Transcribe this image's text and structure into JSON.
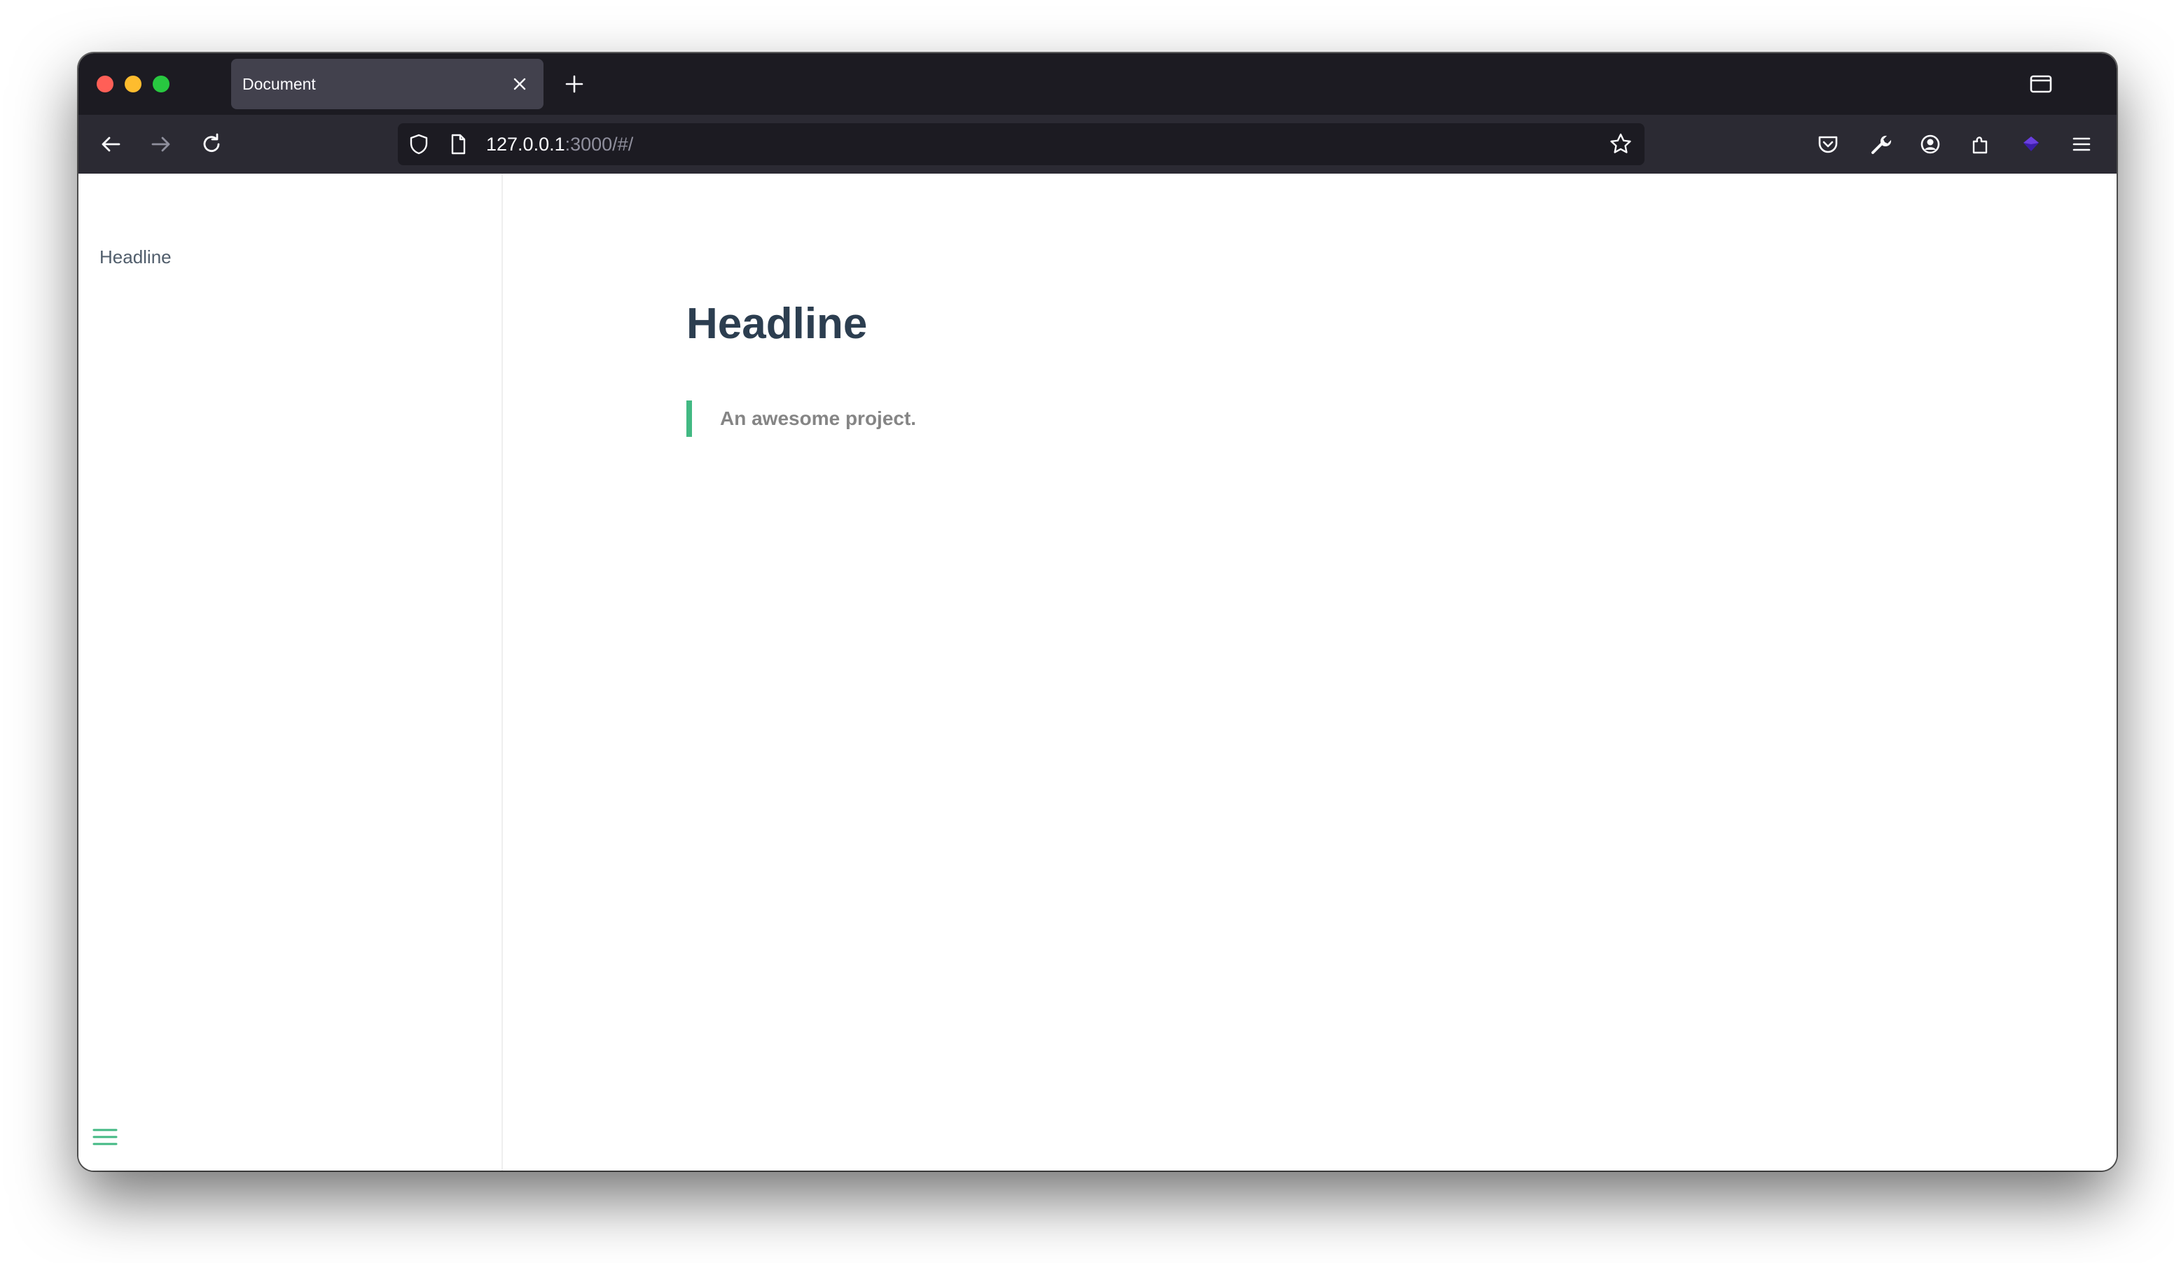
{
  "browser": {
    "tab": {
      "title": "Document"
    },
    "url": {
      "host": "127.0.0.1",
      "rest": ":3000/#/"
    }
  },
  "sidebar": {
    "items": [
      {
        "label": "Headline"
      }
    ]
  },
  "main": {
    "headline": "Headline",
    "tagline": "An awesome project."
  },
  "colors": {
    "accent": "#42b983",
    "heading": "#2c3e50",
    "chrome_dark": "#1c1b22",
    "toolbar": "#2b2a33",
    "tab_active": "#42414d"
  },
  "icons": [
    "close-icon",
    "plus-icon",
    "tab-list-icon",
    "back-arrow-icon",
    "forward-arrow-icon",
    "reload-icon",
    "shield-icon",
    "page-icon",
    "star-icon",
    "pocket-icon",
    "wrench-icon",
    "account-icon",
    "extensions-icon",
    "extension-gem-icon",
    "hamburger-menu-icon"
  ]
}
